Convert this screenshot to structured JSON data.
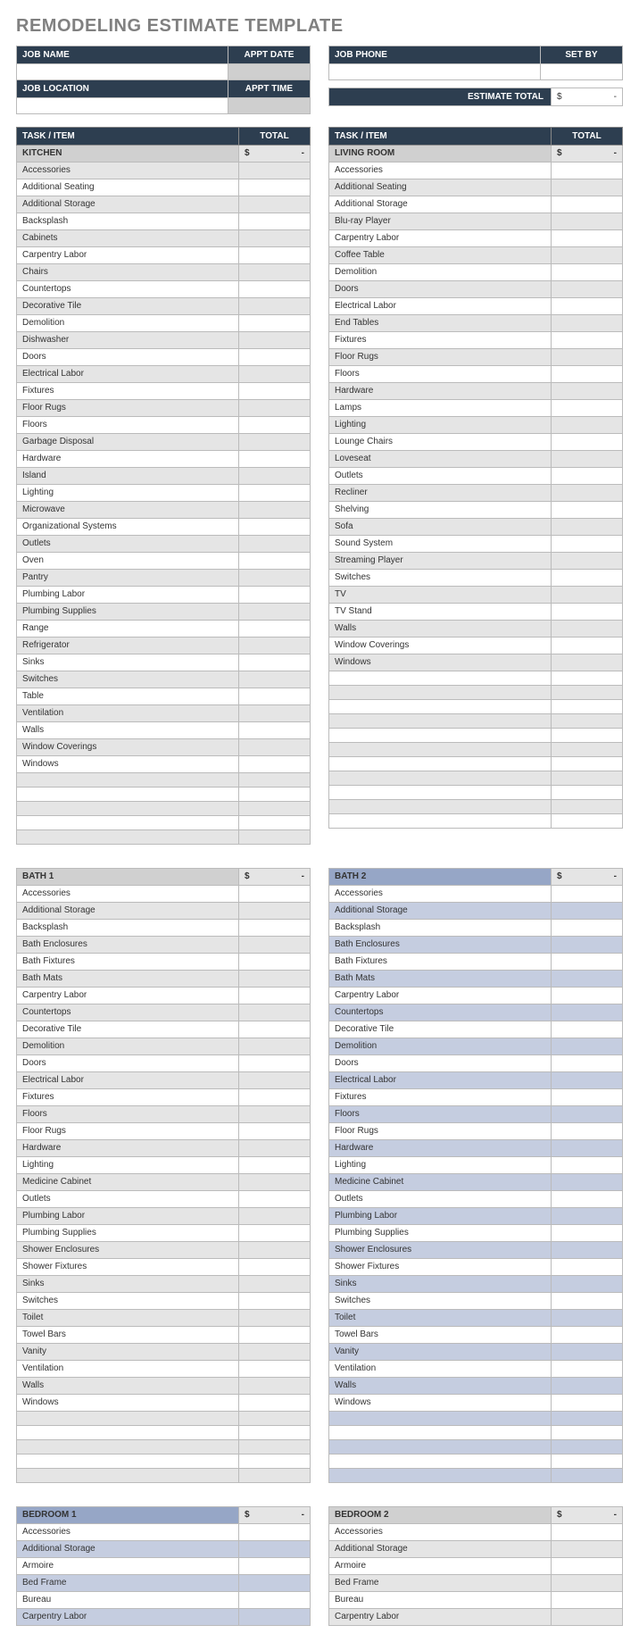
{
  "title": "REMODELING ESTIMATE TEMPLATE",
  "header_left": {
    "job_name": "JOB NAME",
    "appt_date": "APPT DATE",
    "job_location": "JOB LOCATION",
    "appt_time": "APPT TIME"
  },
  "header_right": {
    "job_phone": "JOB PHONE",
    "set_by": "SET BY"
  },
  "estimate_total_label": "ESTIMATE TOTAL",
  "dollar": "$",
  "dash": "-",
  "col_task": "TASK / ITEM",
  "col_total": "TOTAL",
  "sections": [
    {
      "name": "KITCHEN",
      "style": "grey",
      "alt_start": 1,
      "empty_rows": 5,
      "items": [
        "Accessories",
        "Additional Seating",
        "Additional Storage",
        "Backsplash",
        "Cabinets",
        "Carpentry Labor",
        "Chairs",
        "Countertops",
        "Decorative Tile",
        "Demolition",
        "Dishwasher",
        "Doors",
        "Electrical Labor",
        "Fixtures",
        "Floor Rugs",
        "Floors",
        "Garbage Disposal",
        "Hardware",
        "Island",
        "Lighting",
        "Microwave",
        "Organizational Systems",
        "Outlets",
        "Oven",
        "Pantry",
        "Plumbing Labor",
        "Plumbing Supplies",
        "Range",
        "Refrigerator",
        "Sinks",
        "Switches",
        "Table",
        "Ventilation",
        "Walls",
        "Window Coverings",
        "Windows"
      ]
    },
    {
      "name": "LIVING ROOM",
      "style": "grey",
      "alt_start": 0,
      "empty_rows": 11,
      "items": [
        "Accessories",
        "Additional Seating",
        "Additional Storage",
        "Blu-ray Player",
        "Carpentry Labor",
        "Coffee Table",
        "Demolition",
        "Doors",
        "Electrical Labor",
        "End Tables",
        "Fixtures",
        "Floor Rugs",
        "Floors",
        "Hardware",
        "Lamps",
        "Lighting",
        "Lounge Chairs",
        "Loveseat",
        "Outlets",
        "Recliner",
        "Shelving",
        "Sofa",
        "Sound System",
        "Streaming Player",
        "Switches",
        "TV",
        "TV Stand",
        "Walls",
        "Window Coverings",
        "Windows"
      ]
    },
    {
      "name": "BATH 1",
      "style": "grey",
      "alt_start": 0,
      "empty_rows": 5,
      "items": [
        "Accessories",
        "Additional Storage",
        "Backsplash",
        "Bath Enclosures",
        "Bath Fixtures",
        "Bath Mats",
        "Carpentry Labor",
        "Countertops",
        "Decorative Tile",
        "Demolition",
        "Doors",
        "Electrical Labor",
        "Fixtures",
        "Floors",
        "Floor Rugs",
        "Hardware",
        "Lighting",
        "Medicine Cabinet",
        "Outlets",
        "Plumbing Labor",
        "Plumbing Supplies",
        "Shower Enclosures",
        "Shower Fixtures",
        "Sinks",
        "Switches",
        "Toilet",
        "Towel Bars",
        "Vanity",
        "Ventilation",
        "Walls",
        "Windows"
      ]
    },
    {
      "name": "BATH 2",
      "style": "blue",
      "alt_start": 0,
      "empty_rows": 5,
      "items": [
        "Accessories",
        "Additional Storage",
        "Backsplash",
        "Bath Enclosures",
        "Bath Fixtures",
        "Bath Mats",
        "Carpentry Labor",
        "Countertops",
        "Decorative Tile",
        "Demolition",
        "Doors",
        "Electrical Labor",
        "Fixtures",
        "Floors",
        "Floor Rugs",
        "Hardware",
        "Lighting",
        "Medicine Cabinet",
        "Outlets",
        "Plumbing Labor",
        "Plumbing Supplies",
        "Shower Enclosures",
        "Shower Fixtures",
        "Sinks",
        "Switches",
        "Toilet",
        "Towel Bars",
        "Vanity",
        "Ventilation",
        "Walls",
        "Windows"
      ]
    },
    {
      "name": "BEDROOM 1",
      "style": "blue",
      "alt_start": 0,
      "empty_rows": 0,
      "items": [
        "Accessories",
        "Additional Storage",
        "Armoire",
        "Bed Frame",
        "Bureau",
        "Carpentry Labor"
      ]
    },
    {
      "name": "BEDROOM 2",
      "style": "grey",
      "alt_start": 0,
      "empty_rows": 0,
      "items": [
        "Accessories",
        "Additional Storage",
        "Armoire",
        "Bed Frame",
        "Bureau",
        "Carpentry Labor"
      ]
    }
  ]
}
